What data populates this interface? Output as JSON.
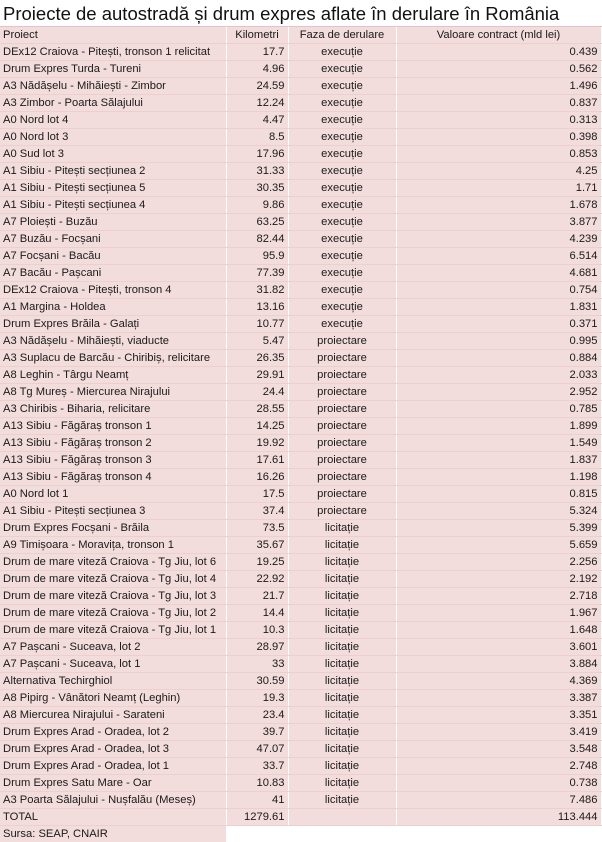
{
  "title": "Proiecte de autostradă și drum expres aflate în derulare în România",
  "headers": {
    "project": "Proiect",
    "km": "Kilometri",
    "phase": "Faza de derulare",
    "value": "Valoare contract (mld lei)"
  },
  "rows": [
    {
      "project": "DEx12 Craiova - Pitești, tronson 1 relicitat",
      "km": "17.7",
      "phase": "execuție",
      "value": "0.439"
    },
    {
      "project": "Drum Expres Turda - Tureni",
      "km": "4.96",
      "phase": "execuție",
      "value": "0.562"
    },
    {
      "project": "A3 Nădășelu - Mihăiești - Zimbor",
      "km": "24.59",
      "phase": "execuție",
      "value": "1.496"
    },
    {
      "project": "A3 Zimbor - Poarta Sălajului",
      "km": "12.24",
      "phase": "execuție",
      "value": "0.837"
    },
    {
      "project": "A0 Nord lot 4",
      "km": "4.47",
      "phase": "execuție",
      "value": "0.313"
    },
    {
      "project": "A0 Nord lot 3",
      "km": "8.5",
      "phase": "execuție",
      "value": "0.398"
    },
    {
      "project": "A0 Sud lot 3",
      "km": "17.96",
      "phase": "execuție",
      "value": "0.853"
    },
    {
      "project": "A1 Sibiu - Pitești secțiunea 2",
      "km": "31.33",
      "phase": "execuție",
      "value": "4.25"
    },
    {
      "project": "A1 Sibiu - Pitești secțiunea 5",
      "km": "30.35",
      "phase": "execuție",
      "value": "1.71"
    },
    {
      "project": "A1 Sibiu - Pitești secțiunea 4",
      "km": "9.86",
      "phase": "execuție",
      "value": "1.678"
    },
    {
      "project": "A7 Ploiești - Buzău",
      "km": "63.25",
      "phase": "execuție",
      "value": "3.877"
    },
    {
      "project": "A7 Buzău - Focșani",
      "km": "82.44",
      "phase": "execuție",
      "value": "4.239"
    },
    {
      "project": "A7 Focșani - Bacău",
      "km": "95.9",
      "phase": "execuție",
      "value": "6.514"
    },
    {
      "project": "A7 Bacău - Pașcani",
      "km": "77.39",
      "phase": "execuție",
      "value": "4.681"
    },
    {
      "project": "DEx12 Craiova - Pitești, tronson 4",
      "km": "31.82",
      "phase": "execuție",
      "value": "0.754"
    },
    {
      "project": "A1 Margina - Holdea",
      "km": "13.16",
      "phase": "execuție",
      "value": "1.831"
    },
    {
      "project": "Drum Expres Brăila - Galați",
      "km": "10.77",
      "phase": "execuție",
      "value": "0.371"
    },
    {
      "project": "A3 Nădășelu - Mihăiești, viaducte",
      "km": "5.47",
      "phase": "proiectare",
      "value": "0.995"
    },
    {
      "project": "A3 Suplacu de Barcău - Chiribiș, relicitare",
      "km": "26.35",
      "phase": "proiectare",
      "value": "0.884"
    },
    {
      "project": "A8 Leghin - Târgu Neamț",
      "km": "29.91",
      "phase": "proiectare",
      "value": "2.033"
    },
    {
      "project": "A8 Tg Mureș - Miercurea Nirajului",
      "km": "24.4",
      "phase": "proiectare",
      "value": "2.952"
    },
    {
      "project": "A3 Chiribis - Biharia, relicitare",
      "km": "28.55",
      "phase": "proiectare",
      "value": "0.785"
    },
    {
      "project": "A13 Sibiu - Făgăraș tronson 1",
      "km": "14.25",
      "phase": "proiectare",
      "value": "1.899"
    },
    {
      "project": "A13 Sibiu - Făgăraș tronson 2",
      "km": "19.92",
      "phase": "proiectare",
      "value": "1.549"
    },
    {
      "project": "A13 Sibiu - Făgăraș tronson 3",
      "km": "17.61",
      "phase": "proiectare",
      "value": "1.837"
    },
    {
      "project": "A13 Sibiu - Făgăraș tronson 4",
      "km": "16.26",
      "phase": "proiectare",
      "value": "1.198"
    },
    {
      "project": "A0 Nord lot 1",
      "km": "17.5",
      "phase": "proiectare",
      "value": "0.815"
    },
    {
      "project": "A1 Sibiu - Pitești secțiunea 3",
      "km": "37.4",
      "phase": "proiectare",
      "value": "5.324"
    },
    {
      "project": "Drum Expres Focșani - Brăila",
      "km": "73.5",
      "phase": "licitație",
      "value": "5.399"
    },
    {
      "project": "A9 Timișoara - Moravița, tronson 1",
      "km": "35.67",
      "phase": "licitație",
      "value": "5.659"
    },
    {
      "project": "Drum de mare viteză Craiova - Tg Jiu, lot 6",
      "km": "19.25",
      "phase": "licitație",
      "value": "2.256"
    },
    {
      "project": "Drum de mare viteză Craiova - Tg Jiu, lot 4",
      "km": "22.92",
      "phase": "licitație",
      "value": "2.192"
    },
    {
      "project": "Drum de mare viteză Craiova - Tg Jiu, lot 3",
      "km": "21.7",
      "phase": "licitație",
      "value": "2.718"
    },
    {
      "project": "Drum de mare viteză Craiova - Tg Jiu, lot 2",
      "km": "14.4",
      "phase": "licitație",
      "value": "1.967"
    },
    {
      "project": "Drum de mare viteză Craiova - Tg Jiu, lot 1",
      "km": "10.3",
      "phase": "licitație",
      "value": "1.648"
    },
    {
      "project": "A7 Pașcani - Suceava, lot 2",
      "km": "28.97",
      "phase": "licitație",
      "value": "3.601"
    },
    {
      "project": "A7 Pașcani - Suceava, lot 1",
      "km": "33",
      "phase": "licitație",
      "value": "3.884"
    },
    {
      "project": "Alternativa Techirghiol",
      "km": "30.59",
      "phase": "licitație",
      "value": "4.369"
    },
    {
      "project": "A8 Pipirg - Vânători Neamț (Leghin)",
      "km": "19.3",
      "phase": "licitație",
      "value": "3.387"
    },
    {
      "project": "A8 Miercurea Nirajului - Sarateni",
      "km": "23.4",
      "phase": "licitație",
      "value": "3.351"
    },
    {
      "project": "Drum Expres Arad - Oradea, lot 2",
      "km": "39.7",
      "phase": "licitație",
      "value": "3.419"
    },
    {
      "project": "Drum Expres Arad - Oradea, lot 3",
      "km": "47.07",
      "phase": "licitație",
      "value": "3.548"
    },
    {
      "project": "Drum Expres Arad - Oradea, lot 1",
      "km": "33.7",
      "phase": "licitație",
      "value": "2.748"
    },
    {
      "project": "Drum Expres Satu Mare - Oar",
      "km": "10.83",
      "phase": "licitație",
      "value": "0.738"
    },
    {
      "project": "A3 Poarta Sălajului - Nușfalău (Meseș)",
      "km": "41",
      "phase": "licitație",
      "value": "7.486"
    }
  ],
  "total": {
    "label": "TOTAL",
    "km": "1279.61",
    "value": "113.444"
  },
  "source": "Sursa: SEAP, CNAIR",
  "colors": {
    "cell_fill": "#f3dcdc",
    "grid_line": "#ffffff"
  }
}
